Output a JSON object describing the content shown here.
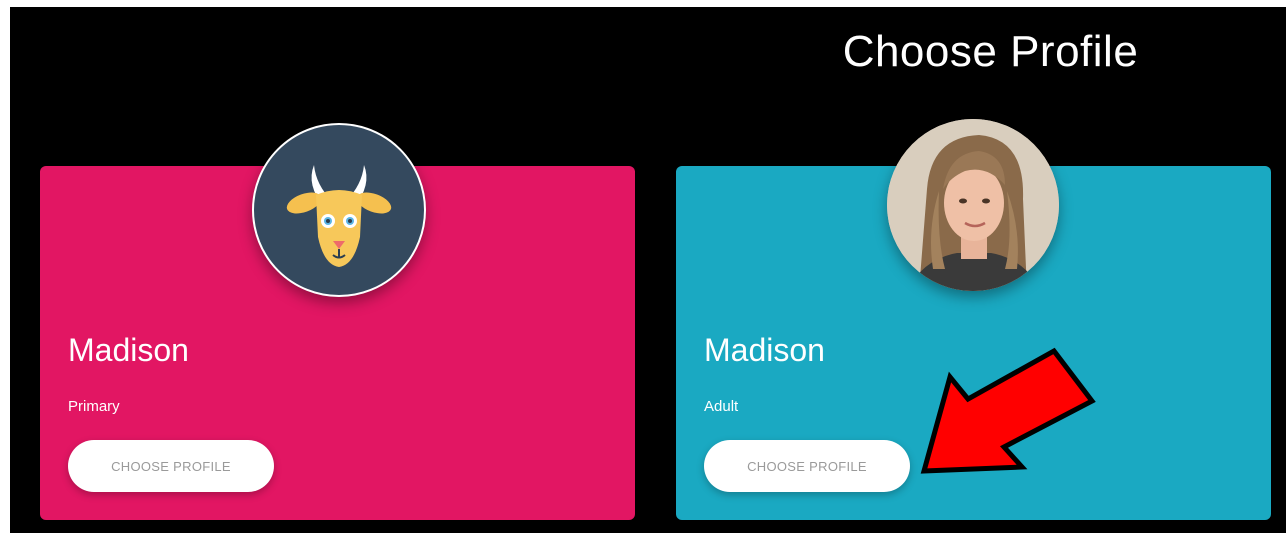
{
  "header": {
    "title": "Choose Profile"
  },
  "colors": {
    "background": "#000000",
    "card_primary": "#e21663",
    "card_adult": "#1aa9c2",
    "button_text": "#9a9a9a",
    "arrow": "#ff0000"
  },
  "profiles": [
    {
      "name": "Madison",
      "role": "Primary",
      "button_label": "CHOOSE PROFILE",
      "avatar": "goat-avatar-icon"
    },
    {
      "name": "Madison",
      "role": "Adult",
      "button_label": "CHOOSE PROFILE",
      "avatar": "user-photo"
    }
  ],
  "annotation": {
    "icon": "red-arrow-pointer",
    "target": "profiles.1.button_label"
  }
}
